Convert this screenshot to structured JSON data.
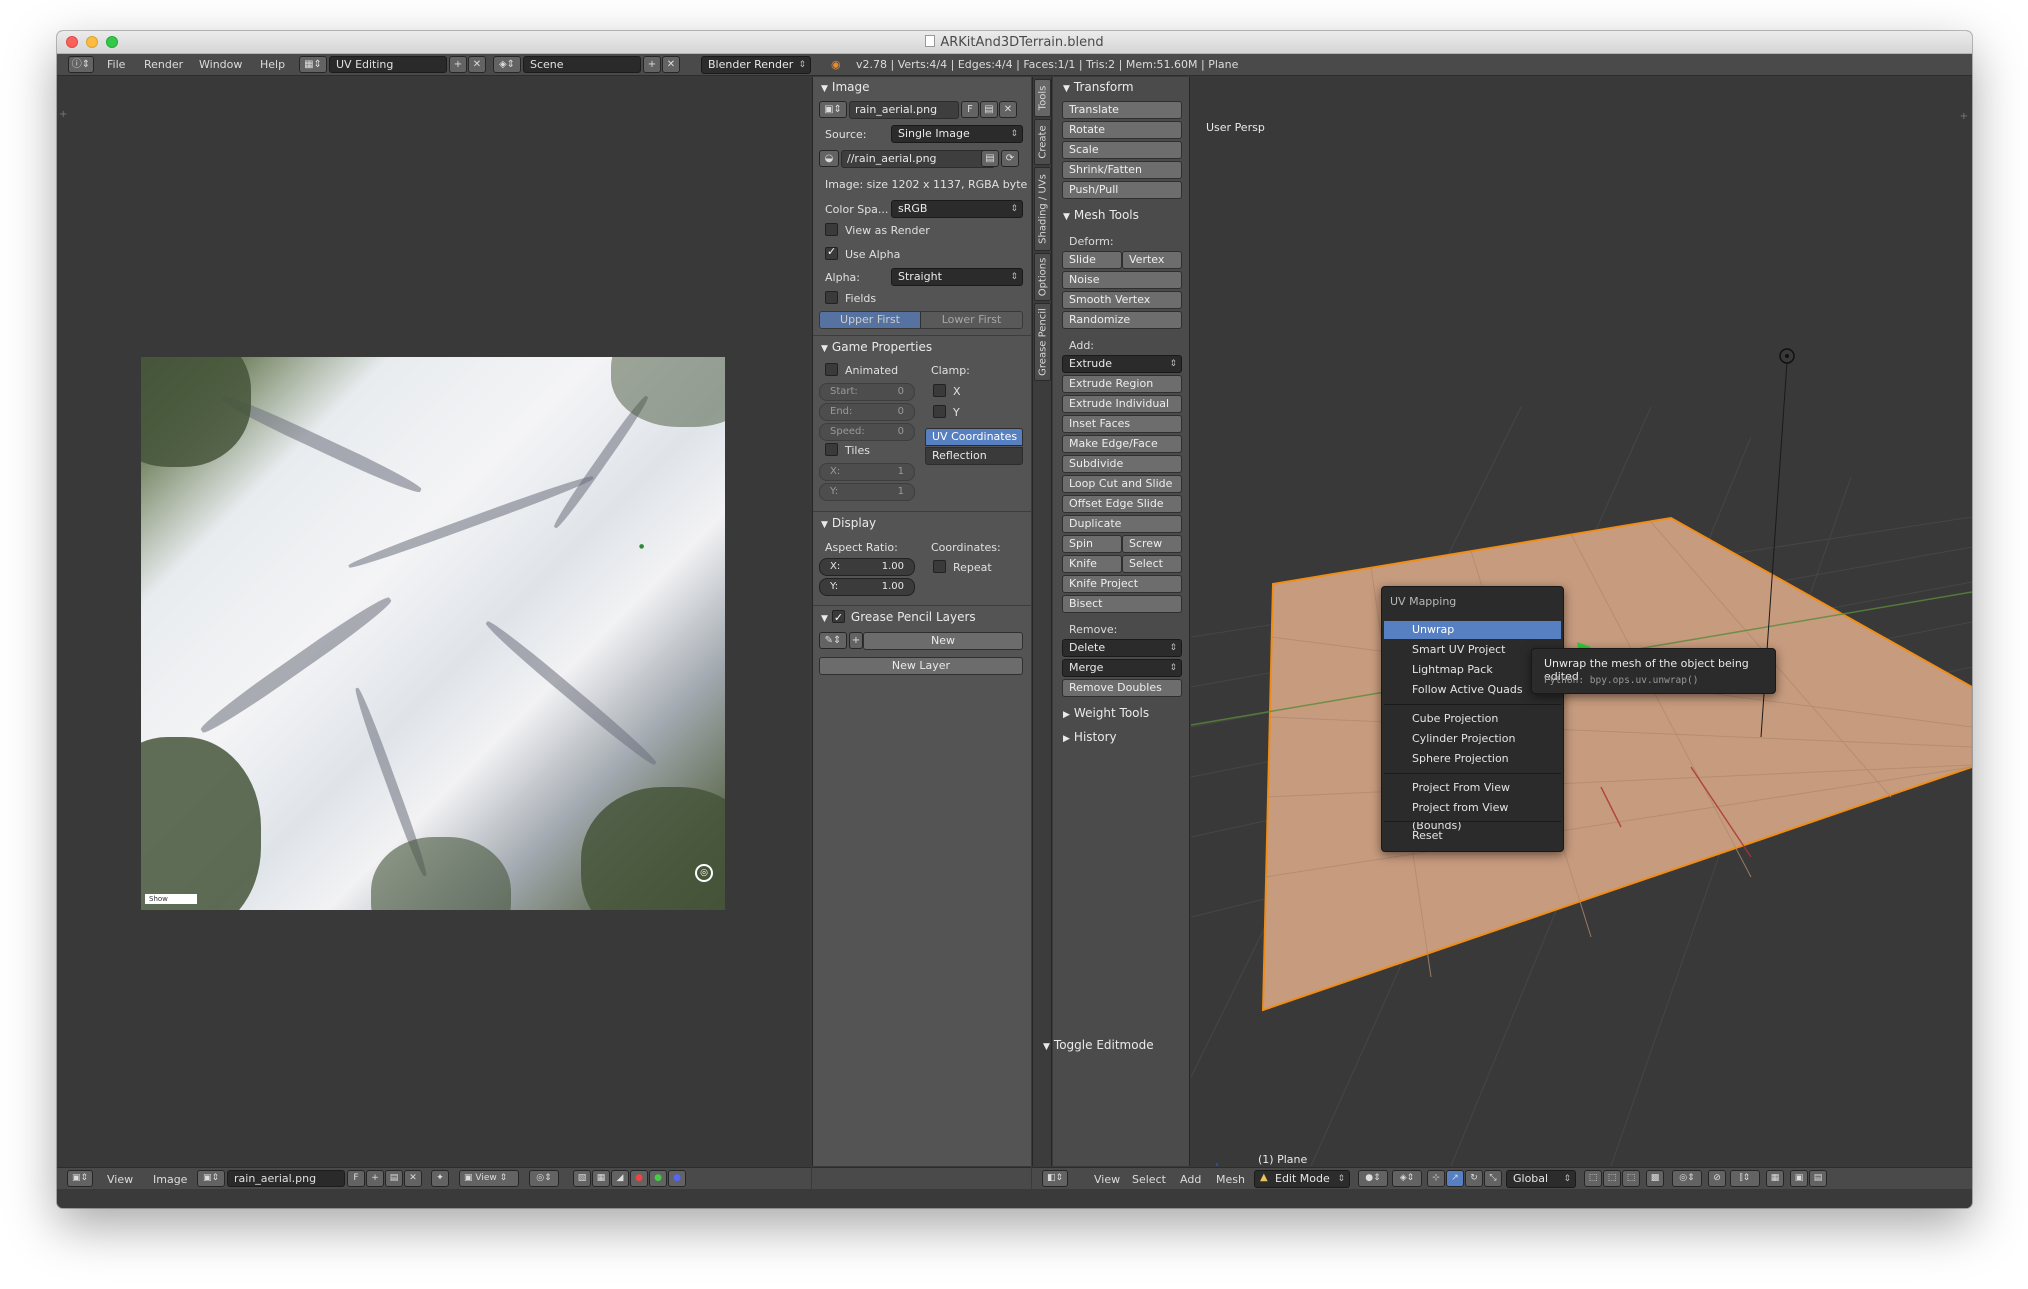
{
  "window": {
    "title": "ARKitAnd3DTerrain.blend"
  },
  "infobar": {
    "menus": [
      "File",
      "Render",
      "Window",
      "Help"
    ],
    "layout": "UV Editing",
    "scene": "Scene",
    "engine": "Blender Render",
    "stats": "v2.78 | Verts:4/4 | Edges:4/4 | Faces:1/1 | Tris:2 | Mem:51.60M | Plane"
  },
  "uv_editor": {
    "image_label": "Show",
    "bottom": {
      "view": "View",
      "image": "Image",
      "image_name": "rain_aerial.png",
      "f_label": "F",
      "view2": "View"
    }
  },
  "properties": {
    "image_header": "Image",
    "image_name": "rain_aerial.png",
    "f_label": "F",
    "source_label": "Source:",
    "source_value": "Single Image",
    "filepath": "//rain_aerial.png",
    "image_info": "Image: size 1202 x 1137, RGBA byte",
    "colorspace_label": "Color Spa...",
    "colorspace_value": "sRGB",
    "view_as_render": "View as Render",
    "use_alpha": "Use Alpha",
    "alpha_label": "Alpha:",
    "alpha_value": "Straight",
    "fields": "Fields",
    "upper_first": "Upper First",
    "lower_first": "Lower First",
    "game_header": "Game Properties",
    "animated": "Animated",
    "clamp": "Clamp:",
    "start_label": "Start:",
    "start_value": "0",
    "end_label": "End:",
    "end_value": "0",
    "speed_label": "Speed:",
    "speed_value": "0",
    "clamp_x": "X",
    "clamp_y": "Y",
    "tiles": "Tiles",
    "uv_coordinates": "UV Coordinates",
    "reflection": "Reflection",
    "tile_x_label": "X:",
    "tile_x_value": "1",
    "tile_y_label": "Y:",
    "tile_y_value": "1",
    "display_header": "Display",
    "aspect_ratio": "Aspect Ratio:",
    "coordinates": "Coordinates:",
    "aspect_x_label": "X:",
    "aspect_x_value": "1.00",
    "aspect_y_label": "Y:",
    "aspect_y_value": "1.00",
    "repeat": "Repeat",
    "grease_header": "Grease Pencil Layers",
    "new": "New",
    "new_layer": "New Layer"
  },
  "vtabs": [
    "Tools",
    "Create",
    "Shading / UVs",
    "Options",
    "Grease Pencil"
  ],
  "tools": {
    "transform_header": "Transform",
    "transform": [
      "Translate",
      "Rotate",
      "Scale",
      "Shrink/Fatten",
      "Push/Pull"
    ],
    "mesh_header": "Mesh Tools",
    "deform_label": "Deform:",
    "slide_edge": "Slide Edge",
    "vertex": "Vertex",
    "deform": [
      "Noise",
      "Smooth Vertex",
      "Randomize"
    ],
    "add_label": "Add:",
    "extrude": "Extrude",
    "add": [
      "Extrude Region",
      "Extrude Individual",
      "Inset Faces",
      "Make Edge/Face",
      "Subdivide",
      "Loop Cut and Slide",
      "Offset Edge Slide",
      "Duplicate"
    ],
    "spin": "Spin",
    "screw": "Screw",
    "knife": "Knife",
    "select": "Select",
    "knife_project": "Knife Project",
    "bisect": "Bisect",
    "remove_label": "Remove:",
    "delete": "Delete",
    "merge": "Merge",
    "remove_doubles": "Remove Doubles",
    "weight_header": "Weight Tools",
    "history_header": "History",
    "toggle_editmode": "Toggle Editmode"
  },
  "viewport": {
    "label": "User Persp",
    "object": "(1) Plane",
    "bottom": {
      "view": "View",
      "select": "Select",
      "add": "Add",
      "mesh": "Mesh",
      "mode": "Edit Mode",
      "orientation": "Global"
    }
  },
  "uv_menu": {
    "title": "UV Mapping",
    "items": [
      "Unwrap",
      "Smart UV Project",
      "Lightmap Pack",
      "Follow Active Quads",
      "Cube Projection",
      "Cylinder Projection",
      "Sphere Projection",
      "Project From View",
      "Project from View (Bounds)",
      "Reset"
    ],
    "highlighted": "Unwrap"
  },
  "tooltip": {
    "text": "Unwrap the mesh of the object being edited",
    "python": "Python: bpy.ops.uv.unwrap()"
  },
  "colors": {
    "accent": "#5680c2",
    "plane": "#c79b7e",
    "selection_edge": "#f08d16"
  }
}
